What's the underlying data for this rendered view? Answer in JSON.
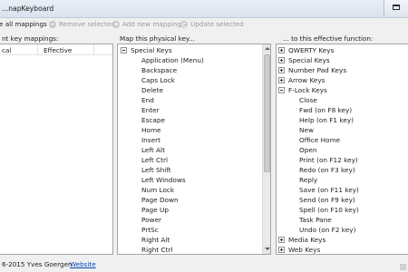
{
  "window": {
    "title": "...napKeyboard"
  },
  "toolbar": {
    "items": [
      {
        "label": "e all mappings",
        "icon": "delete-icon",
        "enabled": true
      },
      {
        "label": "Remove selected",
        "icon": "delete-icon",
        "enabled": false
      },
      {
        "label": "Add new mapping",
        "icon": "plus-icon",
        "enabled": false
      },
      {
        "label": "Update selected",
        "icon": "refresh-icon",
        "enabled": false
      }
    ]
  },
  "left_panel": {
    "label": "nt key mappings:",
    "columns": [
      "cal",
      "Effective"
    ]
  },
  "middle_panel": {
    "label": "Map this physical key...",
    "root": "Special Keys",
    "items": [
      "Application (Menu)",
      "Backspace",
      "Caps Lock",
      "Delete",
      "End",
      "Enter",
      "Escape",
      "Home",
      "Insert",
      "Left Alt",
      "Left Ctrl",
      "Left Shift",
      "Left Windows",
      "Num Lock",
      "Page Down",
      "Page Up",
      "Power",
      "PrtSc",
      "Right Alt",
      "Right Ctrl"
    ]
  },
  "right_panel": {
    "label": "... to this effective function:",
    "groups_top": [
      "QWERTY Keys",
      "Special Keys",
      "Number Pad Keys",
      "Arrow Keys"
    ],
    "expanded_group": "F-Lock Keys",
    "expanded_items": [
      "Close",
      "Fwd (on F8 key)",
      "Help (on F1 key)",
      "New",
      "Office Home",
      "Open",
      "Print (on F12 key)",
      "Redo (on F3 key)",
      "Reply",
      "Save (on F11 key)",
      "Send (on F9 key)",
      "Spell (on F10 key)",
      "Task Pane",
      "Undo (on F2 key)"
    ],
    "groups_bottom": [
      "Media Keys",
      "Web Keys"
    ]
  },
  "status": {
    "copyright": "6-2015 Yves Goergen",
    "link": "Website"
  }
}
